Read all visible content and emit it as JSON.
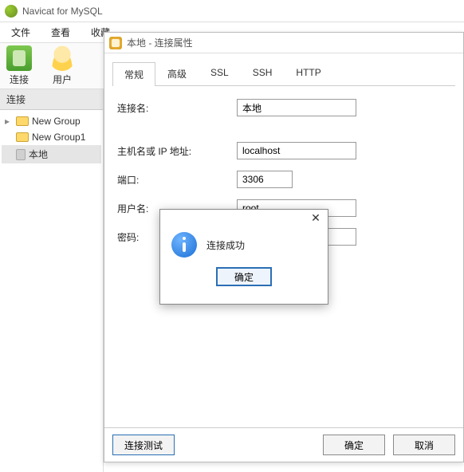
{
  "app": {
    "title": "Navicat for MySQL"
  },
  "menu": {
    "items": [
      "文件",
      "查看",
      "收藏"
    ]
  },
  "toolbar": {
    "connect": "连接",
    "user": "用户"
  },
  "sidebar": {
    "header": "连接",
    "nodes": [
      {
        "label": "New Group",
        "type": "folder",
        "twisty": "▸"
      },
      {
        "label": "New Group1",
        "type": "folder",
        "twisty": ""
      },
      {
        "label": "本地",
        "type": "db",
        "twisty": ""
      }
    ]
  },
  "dialog": {
    "title": "本地 - 连接属性",
    "tabs": [
      "常规",
      "高级",
      "SSL",
      "SSH",
      "HTTP"
    ],
    "activeTab": 0,
    "fields": {
      "name_label": "连接名:",
      "name_value": "本地",
      "host_label": "主机名或 IP 地址:",
      "host_value": "localhost",
      "port_label": "端口:",
      "port_value": "3306",
      "user_label": "用户名:",
      "user_value": "root",
      "pass_label": "密码:",
      "pass_value": "••••"
    },
    "buttons": {
      "test": "连接测试",
      "ok": "确定",
      "cancel": "取消"
    }
  },
  "msgbox": {
    "text": "连接成功",
    "ok": "确定"
  }
}
